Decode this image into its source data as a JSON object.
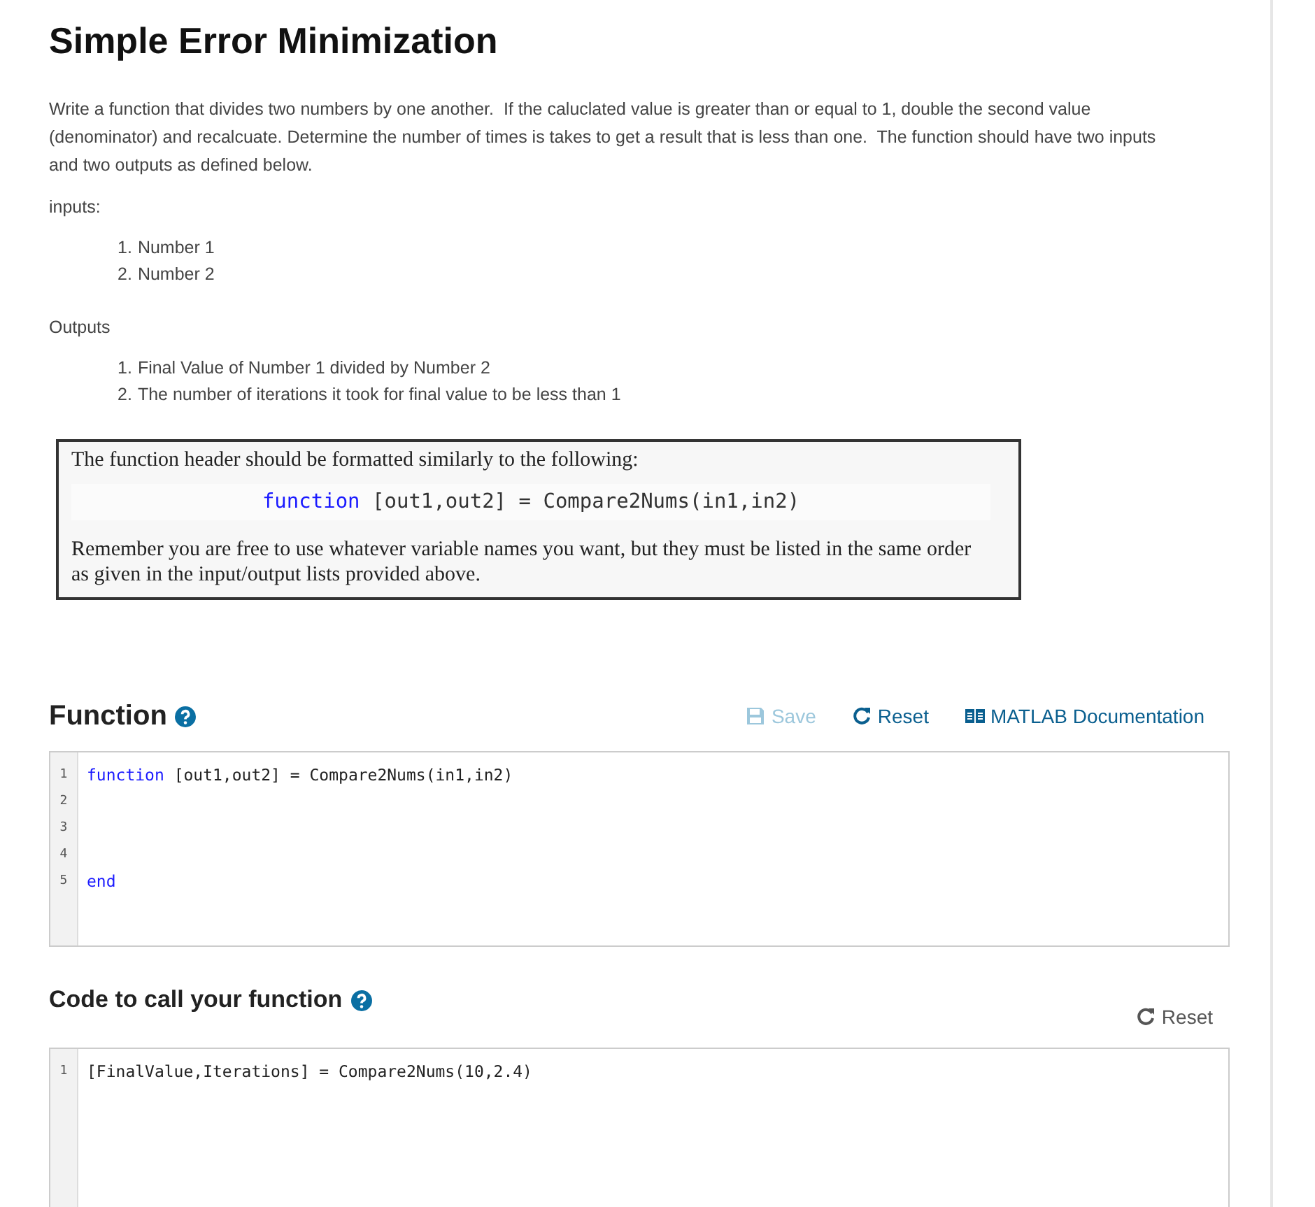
{
  "title": "Simple Error Minimization",
  "description": "Write a function that divides two numbers by one another.  If the caluclated value is greater than or equal to 1, double the second value (denominator) and recalcuate. Determine the number of times is takes to get a result that is less than one.  The function should have two inputs and two outputs as defined below.",
  "lists": [
    {
      "heading": "inputs:",
      "items": [
        {
          "marker": "1.",
          "text": "Number 1"
        },
        {
          "marker": "2.",
          "text": "Number 2"
        }
      ]
    },
    {
      "heading": "Outputs",
      "items": [
        {
          "marker": "1.",
          "text": "Final Value of Number 1 divided by Number 2"
        },
        {
          "marker": "2.",
          "text": "The number of iterations it took for final value to be less than 1"
        }
      ]
    }
  ],
  "note": {
    "intro": "The function header should be formatted similarly to the following:",
    "code": [
      {
        "kind": "keyword",
        "text": "function"
      },
      {
        "kind": "plain",
        "text": " [out1,out2] = Compare2Nums(in1,in2)"
      }
    ],
    "outro": "Remember you are free to use whatever variable names you want, but they must be listed in the same order as given in the input/output lists provided above."
  },
  "function_section": {
    "heading": "Function",
    "actions": [
      {
        "kind": "save",
        "label": "Save",
        "disabled": true
      },
      {
        "kind": "reset",
        "label": "Reset",
        "disabled": false
      },
      {
        "kind": "docs",
        "label": "MATLAB Documentation",
        "disabled": false
      }
    ],
    "lines": [
      {
        "number": "1",
        "tokens": [
          {
            "kind": "keyword",
            "text": "function"
          },
          {
            "kind": "plain",
            "text": " [out1,out2] = Compare2Nums(in1,in2)"
          }
        ]
      },
      {
        "number": "2"
      },
      {
        "number": "3"
      },
      {
        "number": "4"
      },
      {
        "number": "5",
        "tokens": [
          {
            "kind": "keyword",
            "text": "end"
          }
        ]
      }
    ]
  },
  "call_section": {
    "heading": "Code to call your function",
    "actions": [
      {
        "kind": "reset",
        "label": "Reset"
      }
    ],
    "lines": [
      {
        "number": "1",
        "tokens": [
          {
            "kind": "plain",
            "text": "[FinalValue,Iterations] = Compare2Nums(10,2.4)"
          }
        ]
      }
    ]
  }
}
